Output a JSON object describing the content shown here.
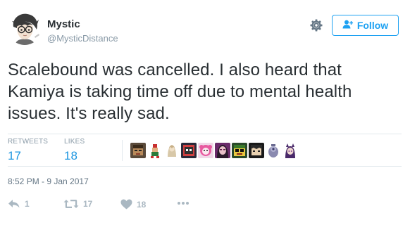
{
  "user": {
    "display_name": "Mystic",
    "handle": "@MysticDistance"
  },
  "follow_button": {
    "label": "Follow"
  },
  "tweet": {
    "text": "Scalebound was cancelled. I also heard that Kamiya is taking time off due to mental health issues. It's really sad."
  },
  "stats": {
    "retweets_label": "RETWEETS",
    "retweets_count": "17",
    "likes_label": "LIKES",
    "likes_count": "18"
  },
  "timestamp": "8:52 PM - 9 Jan 2017",
  "actions": {
    "reply_count": "1",
    "retweet_count": "17",
    "like_count": "18"
  },
  "icons": {
    "gear": "gear-icon",
    "follow": "add-user-icon",
    "reply": "reply-icon",
    "retweet": "retweet-icon",
    "like": "heart-icon",
    "more": "more-icon"
  },
  "colors": {
    "accent": "#1da1f2",
    "link": "#1b95e0",
    "muted": "#8899a6",
    "action": "#aab8c2",
    "text": "#292f33"
  }
}
